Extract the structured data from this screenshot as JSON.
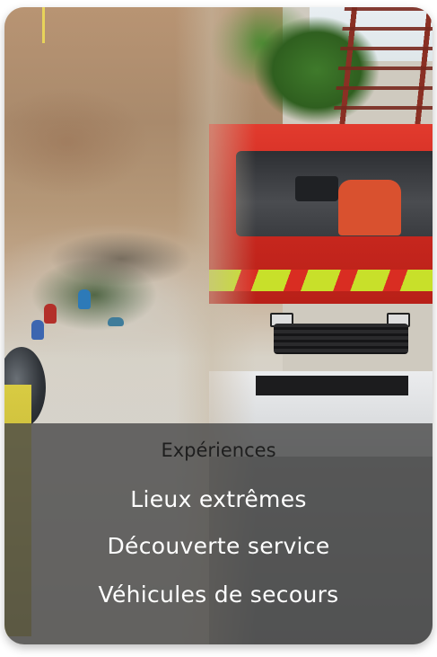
{
  "card": {
    "title": "Expériences",
    "items": [
      {
        "label": "Lieux extrêmes"
      },
      {
        "label": "Découverte service"
      },
      {
        "label": "Véhicules de secours"
      }
    ]
  },
  "images": {
    "left": "cliff-rescue-photo",
    "right": "fire-truck-photo"
  },
  "colors": {
    "overlay": "#484848",
    "title": "#1e1e1e",
    "item_text": "#ffffff",
    "truck_red": "#d92d22",
    "hazard_yellow": "#c8e02a"
  }
}
